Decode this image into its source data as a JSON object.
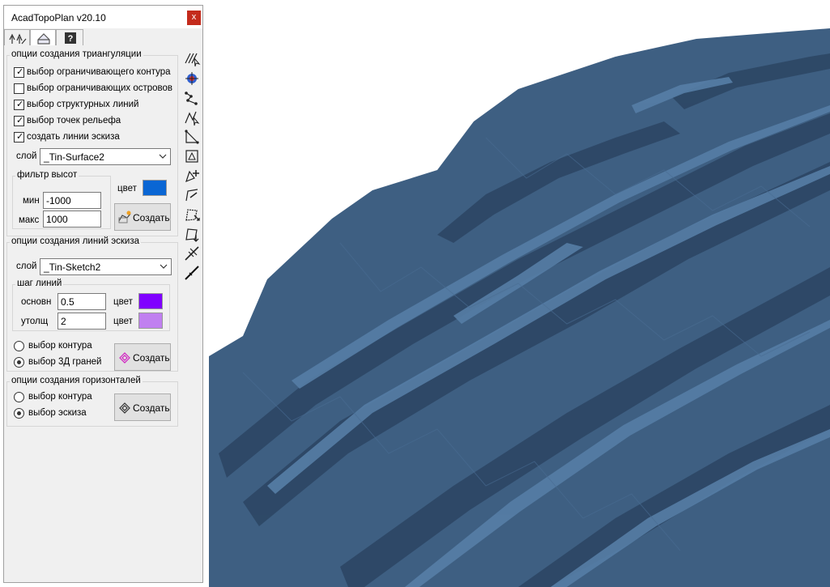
{
  "window": {
    "title": "AcadTopoPlan v20.10",
    "close_label": "x"
  },
  "tabs": [
    {
      "icon": "trees-icon",
      "active": false
    },
    {
      "icon": "house-icon",
      "active": true
    },
    {
      "icon": "help-icon",
      "label": "?",
      "active": false
    }
  ],
  "triangulation": {
    "legend": "опции создания триангуляции",
    "checkboxes": [
      {
        "label": "выбор ограничивающего контура",
        "checked": true
      },
      {
        "label": "выбор ограничивающих островов",
        "checked": false
      },
      {
        "label": "выбор структурных линий",
        "checked": true
      },
      {
        "label": "выбор точек рельефа",
        "checked": true
      },
      {
        "label": "создать линии эскиза",
        "checked": true
      }
    ],
    "layer_label": "слой",
    "layer_value": "_Tin-Surface2",
    "filter": {
      "legend": "фильтр высот",
      "min_label": "мин",
      "min_value": "-1000",
      "max_label": "макс",
      "max_value": "1000"
    },
    "color_label": "цвет",
    "color": "#0a66d4",
    "create_label": "Создать"
  },
  "sketch": {
    "legend": "опции создания линий эскиза",
    "layer_label": "слой",
    "layer_value": "_Tin-Sketch2",
    "step": {
      "legend": "шаг линий",
      "main_label": "основн",
      "main_value": "0.5",
      "main_color_label": "цвет",
      "main_color": "#8000ff",
      "thick_label": "утолщ",
      "thick_value": "2",
      "thick_color_label": "цвет",
      "thick_color": "#c080f0"
    },
    "radios": [
      {
        "label": "выбор контура",
        "selected": false
      },
      {
        "label": "выбор 3Д граней",
        "selected": true
      }
    ],
    "create_label": "Создать"
  },
  "contours": {
    "legend": "опции создания горизонталей",
    "radios": [
      {
        "label": "выбор контура",
        "selected": false
      },
      {
        "label": "выбор эскиза",
        "selected": true
      }
    ],
    "create_label": "Создать"
  },
  "toolbar_icons": [
    "triangulate-select-icon",
    "point-cloud-icon",
    "polyline-nodes-icon",
    "break-lines-icon",
    "triangle-edge-icon",
    "boundary-box-icon",
    "add-point-icon",
    "edit-edge-icon",
    "move-point-icon",
    "delete-point-icon",
    "flip-edge-icon",
    "line-tool-icon"
  ],
  "colors": {
    "terrain_base": "#3e5f82",
    "terrain_light": "#567ea6",
    "terrain_dark": "#2c4563",
    "close_button": "#c42b1c"
  }
}
